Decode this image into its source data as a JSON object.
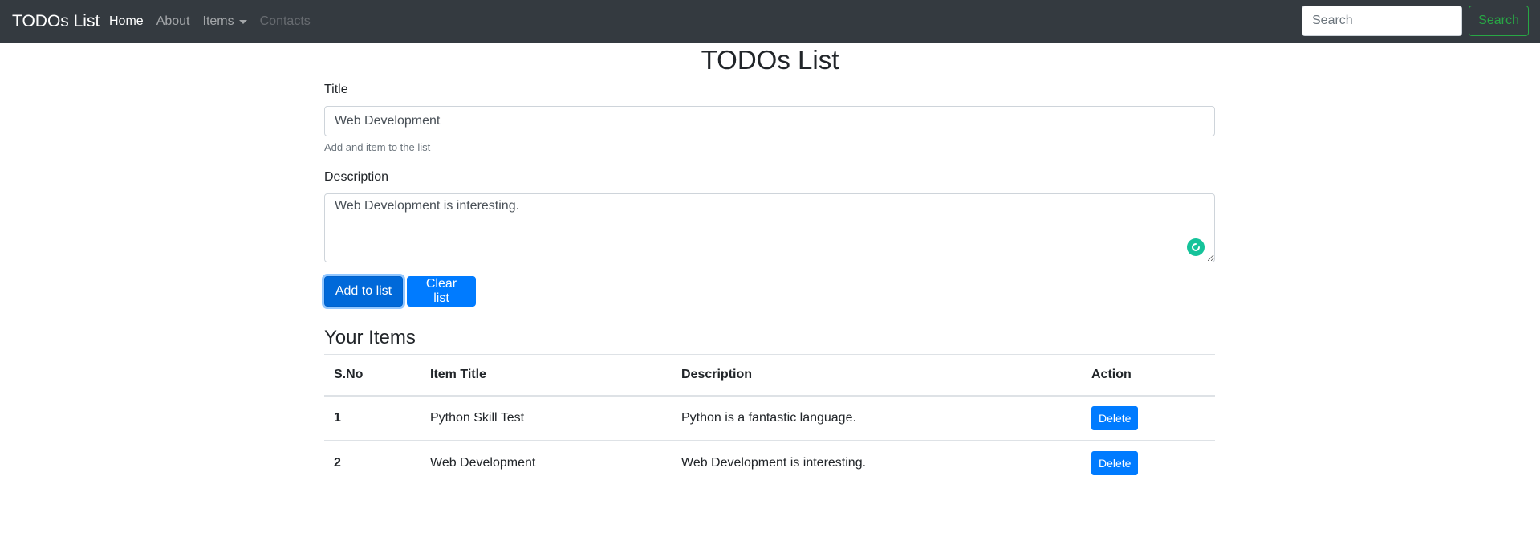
{
  "navbar": {
    "brand": "TODOs List",
    "links": [
      {
        "label": "Home"
      },
      {
        "label": "About"
      },
      {
        "label": "Items"
      },
      {
        "label": "Contacts"
      }
    ],
    "search_placeholder": "Search",
    "search_button": "Search"
  },
  "main": {
    "title": "TODOs List",
    "form": {
      "title_label": "Title",
      "title_value": "Web Development",
      "title_help": "Add and item to the list",
      "description_label": "Description",
      "description_value": "Web Development is interesting."
    },
    "buttons": {
      "add": "Add to list",
      "clear": "Clear list"
    },
    "items_heading": "Your Items",
    "table": {
      "headers": [
        "S.No",
        "Item Title",
        "Description",
        "Action"
      ],
      "rows": [
        {
          "sno": "1",
          "title": "Python Skill Test",
          "description": "Python is a fantastic language.",
          "action": "Delete"
        },
        {
          "sno": "2",
          "title": "Web Development",
          "description": "Web Development is interesting.",
          "action": "Delete"
        }
      ]
    }
  },
  "colors": {
    "navbar_bg": "#343a40",
    "primary": "#007bff",
    "success": "#28a745",
    "grammar_icon": "#15c39a"
  }
}
